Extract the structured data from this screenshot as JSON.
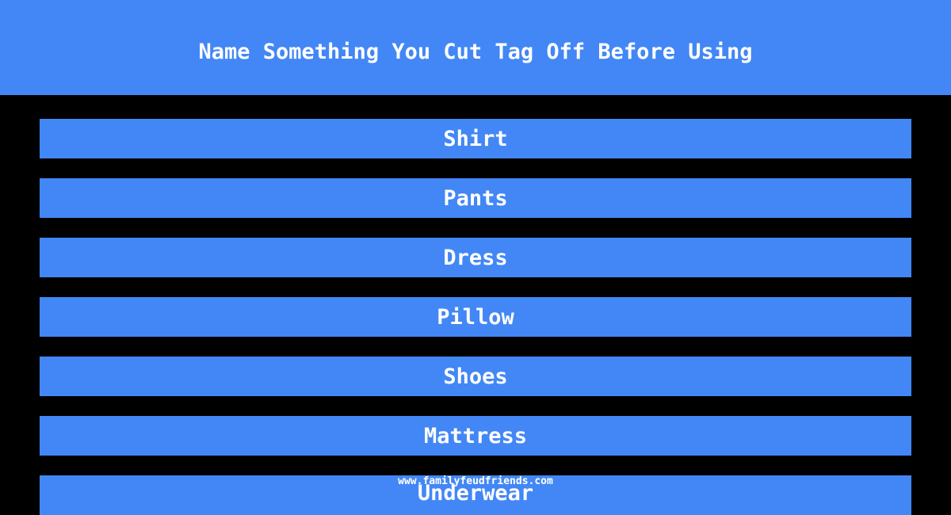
{
  "header": {
    "title": "Name Something You Cut Tag Off Before Using"
  },
  "answers": [
    {
      "label": "Shirt"
    },
    {
      "label": "Pants"
    },
    {
      "label": "Dress"
    },
    {
      "label": "Pillow"
    },
    {
      "label": "Shoes"
    },
    {
      "label": "Mattress"
    },
    {
      "label": "Underwear"
    }
  ],
  "footer": {
    "watermark": "www.familyfeudfriends.com"
  },
  "colors": {
    "accent": "#4287f5",
    "background": "#000000",
    "text": "#ffffff"
  }
}
